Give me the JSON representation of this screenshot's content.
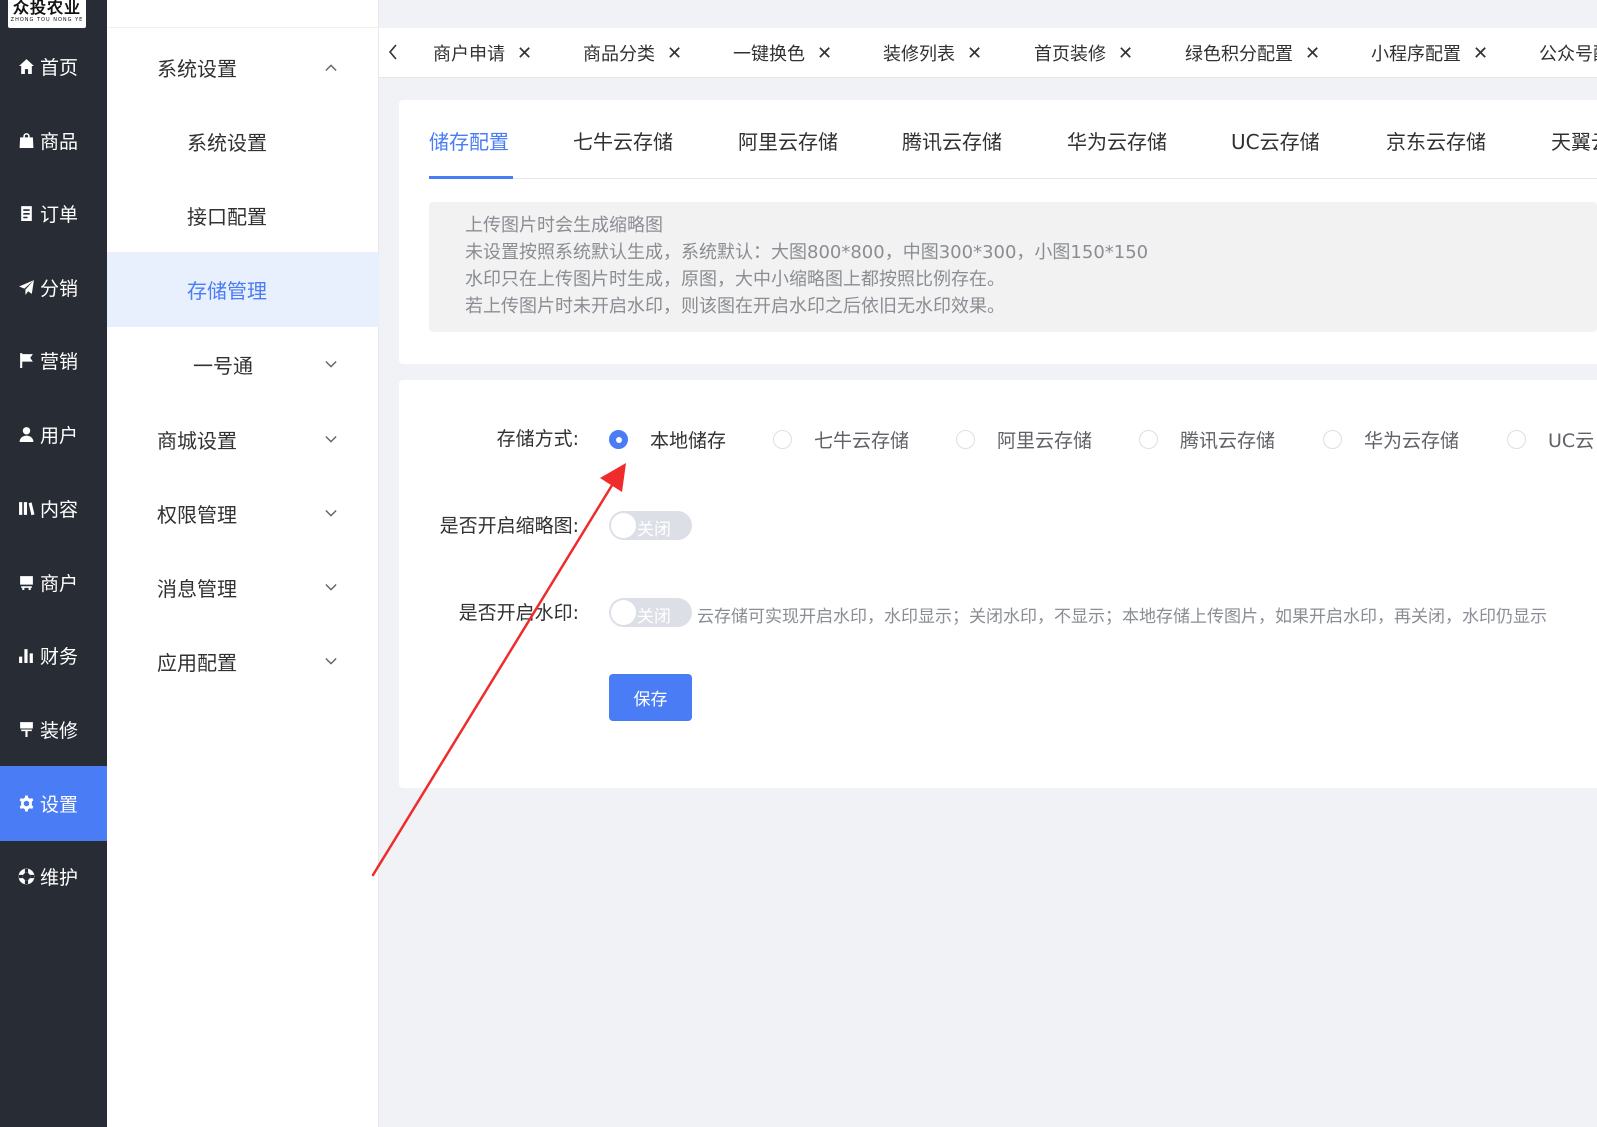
{
  "app": {
    "logo_text": "众投农业",
    "logo_subtext": "ZHONG TOU NONG YE"
  },
  "sidebar": {
    "items": [
      {
        "label": "首页",
        "icon": "home-icon"
      },
      {
        "label": "商品",
        "icon": "shopping-bag-icon"
      },
      {
        "label": "订单",
        "icon": "order-icon"
      },
      {
        "label": "分销",
        "icon": "paper-plane-icon"
      },
      {
        "label": "营销",
        "icon": "flag-icon"
      },
      {
        "label": "用户",
        "icon": "user-icon"
      },
      {
        "label": "内容",
        "icon": "content-icon"
      },
      {
        "label": "商户",
        "icon": "merchant-icon"
      },
      {
        "label": "财务",
        "icon": "bar-chart-icon"
      },
      {
        "label": "装修",
        "icon": "paint-roller-icon"
      },
      {
        "label": "设置",
        "icon": "gear-icon",
        "active": true
      },
      {
        "label": "维护",
        "icon": "lifebuoy-icon"
      }
    ]
  },
  "submenu": {
    "items": [
      {
        "label": "系统设置",
        "level": 1,
        "expanded": true
      },
      {
        "label": "系统设置",
        "level": 2
      },
      {
        "label": "接口配置",
        "level": 2
      },
      {
        "label": "存储管理",
        "level": 2,
        "active": true
      },
      {
        "label": "一号通",
        "level": 2,
        "expanded": false
      },
      {
        "label": "商城设置",
        "level": 1,
        "expanded": false
      },
      {
        "label": "权限管理",
        "level": 1,
        "expanded": false
      },
      {
        "label": "消息管理",
        "level": 1,
        "expanded": false
      },
      {
        "label": "应用配置",
        "level": 1,
        "expanded": false
      }
    ]
  },
  "page_tabs": [
    {
      "label": "商户申请"
    },
    {
      "label": "商品分类"
    },
    {
      "label": "一键换色"
    },
    {
      "label": "装修列表"
    },
    {
      "label": "首页装修"
    },
    {
      "label": "绿色积分配置"
    },
    {
      "label": "小程序配置"
    },
    {
      "label": "公众号配"
    }
  ],
  "storage_tabs": [
    {
      "label": "储存配置",
      "active": true
    },
    {
      "label": "七牛云存储"
    },
    {
      "label": "阿里云存储"
    },
    {
      "label": "腾讯云存储"
    },
    {
      "label": "华为云存储"
    },
    {
      "label": "UC云存储"
    },
    {
      "label": "京东云存储"
    },
    {
      "label": "天翼云"
    }
  ],
  "notice": {
    "lines": [
      "上传图片时会生成缩略图",
      "未设置按照系统默认生成，系统默认：大图800*800，中图300*300，小图150*150",
      "水印只在上传图片时生成，原图，大中小缩略图上都按照比例存在。",
      "若上传图片时未开启水印，则该图在开启水印之后依旧无水印效果。"
    ]
  },
  "form": {
    "storage_label": "存储方式:",
    "storage_options": [
      {
        "label": "本地储存",
        "checked": true
      },
      {
        "label": "七牛云存储",
        "checked": false
      },
      {
        "label": "阿里云存储",
        "checked": false
      },
      {
        "label": "腾讯云存储",
        "checked": false
      },
      {
        "label": "华为云存储",
        "checked": false
      },
      {
        "label": "UC云",
        "checked": false
      }
    ],
    "thumbnail_label": "是否开启缩略图:",
    "thumbnail_switch_text": "关闭",
    "thumbnail_on": false,
    "watermark_label": "是否开启水印:",
    "watermark_switch_text": "关闭",
    "watermark_on": false,
    "watermark_hint": "云存储可实现开启水印，水印显示；关闭水印，不显示；本地存储上传图片，如果开启水印，再关闭，水印仍显示",
    "save_label": "保存"
  },
  "colors": {
    "accent": "#4a7cf6",
    "sidebar_bg": "#282c34",
    "annotation_arrow": "#ef2b2b"
  }
}
